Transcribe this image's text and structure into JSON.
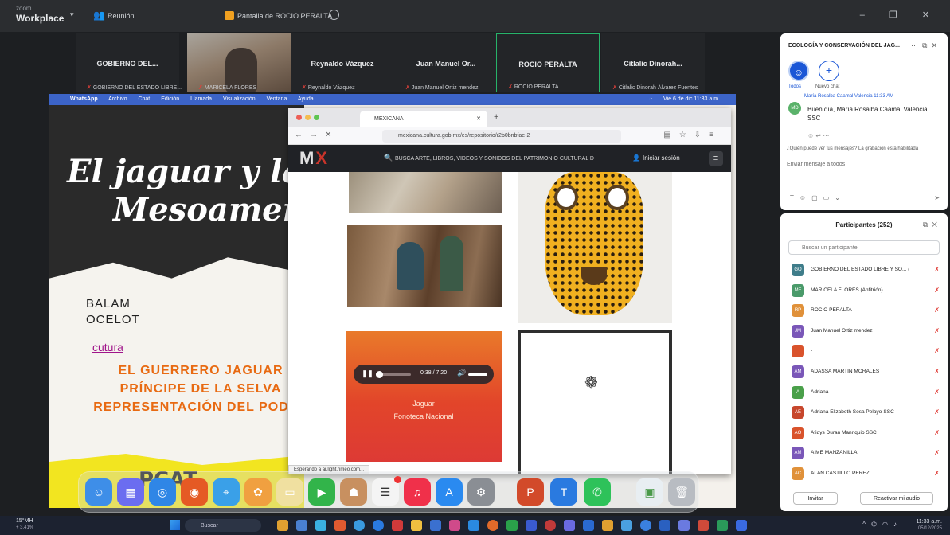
{
  "zoom": {
    "logo_line1": "zoom",
    "logo_line2": "Workplace",
    "meeting_label": "Reunión",
    "share_label": "Pantalla de ROCIO PERALTA",
    "window_controls": "– ❐ ✕"
  },
  "strip": {
    "tiles": [
      {
        "name": "GOBIERNO DEL...",
        "sub": "GOBIERNO DEL ESTADO LIBRE..."
      },
      {
        "name": "",
        "sub": "MARICELA FLORES"
      },
      {
        "name": "Reynaldo Vázquez",
        "sub": "Reynaldo Vázquez"
      },
      {
        "name": "Juan Manuel Or...",
        "sub": "Juan Manuel Ortiz mendez"
      },
      {
        "name": "ROCIO PERALTA",
        "sub": "ROCIO PERALTA"
      },
      {
        "name": "Citlalic Dinorah...",
        "sub": "Citlalic Dinorah Álvarez Fuentes"
      }
    ]
  },
  "mac_menu": {
    "items": [
      "WhatsApp",
      "Archivo",
      "Chat",
      "Edición",
      "Llamada",
      "Visualización",
      "Ventana",
      "Ayuda"
    ],
    "clock": "Vie 6 de dic  11:33 a.m."
  },
  "slide": {
    "title_line1": "El jaguar y las c",
    "title_line2": "Mesoameric",
    "balam": "BALAM",
    "ocelot": "OCELOT",
    "cultura": "cutura",
    "list": [
      "EL GUERRERO JAGUAR",
      "PRÍNCIPE DE LA SELVA",
      "REPRESENTACIÓN DEL POD"
    ],
    "bottom": "PCAT"
  },
  "browser": {
    "tab_title": "MEXICANA",
    "url": "mexicana.cultura.gob.mx/es/repositorio/r2b0bnbfae-2",
    "site_logo_m": "M",
    "site_logo_x": "X",
    "search_placeholder": "BUSCA ARTE, LIBROS, VIDEOS Y SONIDOS DEL PATRIMONIO CULTURAL DE MÉ...",
    "login": "Iniciar sesión",
    "audio": {
      "time": "0:38 / 7:20",
      "progress": 0.09,
      "title": "Jaguar",
      "subtitle": "Fonoteca Nacional"
    },
    "status_url": "Esperando a ar.light.rimeo.com..."
  },
  "chat": {
    "title": "ECOLOGÍA Y CONSERVACIÓN DEL JAG...",
    "todos_label": "Todos",
    "add_label": "Nuevo chat",
    "sender": "María Rosalba Caamal Valencia 11:33 AM",
    "avatar": "MD",
    "message": "Buen día, María Rosalba Caamal Valencia. SSC",
    "who_can_see": "¿Quién puede ver tus mensajes? La grabación está habilitada",
    "input_placeholder": "Enviar mensaje a todos"
  },
  "participants": {
    "title": "Participantes (252)",
    "search_placeholder": "Buscar un participante",
    "list": [
      {
        "initials": "GO",
        "name": "GOBIERNO DEL ESTADO LIBRE Y SO... (Yo)",
        "color": "#3f7d8a"
      },
      {
        "initials": "MF",
        "name": "MARICELA FLORES (Anfitrión)",
        "color": "#4a9a6a"
      },
      {
        "initials": "RP",
        "name": "ROCIO PERALTA",
        "color": "#e0913a"
      },
      {
        "initials": "JM",
        "name": "Juan Manuel Ortiz mendez",
        "color": "#7a57b8"
      },
      {
        "initials": "",
        "name": "-",
        "color": "#d9532c"
      },
      {
        "initials": "AM",
        "name": "ADASSA MARTIN MORALES",
        "color": "#7a57b8"
      },
      {
        "initials": "A",
        "name": "Adriana",
        "color": "#4aa04a"
      },
      {
        "initials": "AE",
        "name": "Adriana Elizabeth Sosa Pelayo-SSC",
        "color": "#c7472c"
      },
      {
        "initials": "AO",
        "name": "Afidys Duran Manriquio SSC",
        "color": "#d9532c"
      },
      {
        "initials": "AM",
        "name": "AIME MANZANILLA",
        "color": "#7a57b8"
      },
      {
        "initials": "AC",
        "name": "ALAN CASTILLO PÉREZ",
        "color": "#e0913a"
      }
    ],
    "invite": "Invitar",
    "unmute": "Reactivar mi audio"
  },
  "taskbar": {
    "weather_temp": "15°MH",
    "weather_sub": "+ 3.41%",
    "search_placeholder": "Buscar",
    "clock_time": "11:33 a.m.",
    "clock_date": "05/12/2025"
  }
}
